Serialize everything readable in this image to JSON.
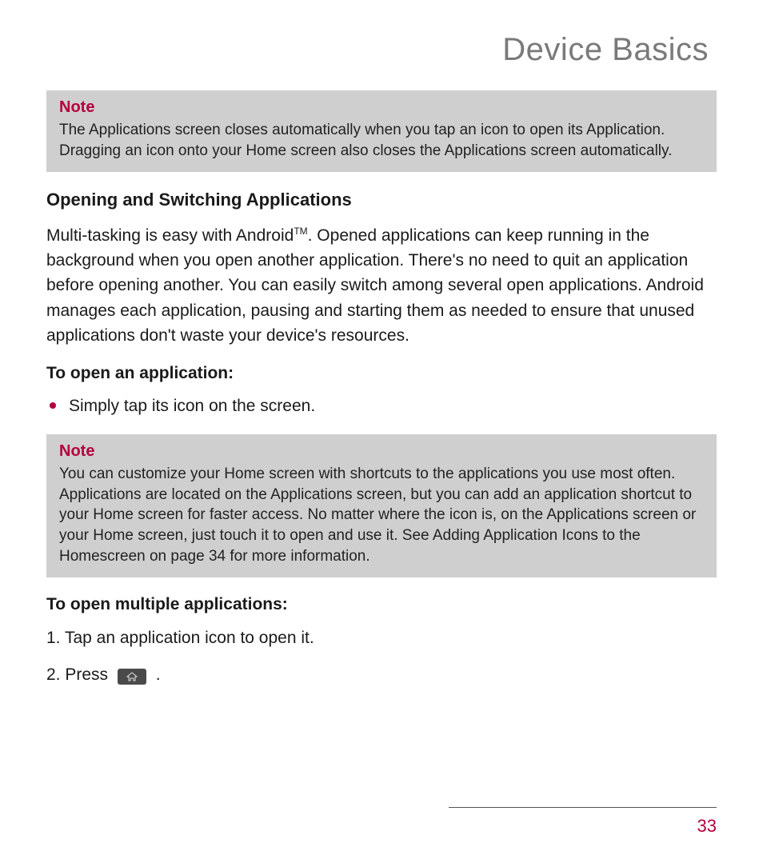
{
  "page_title": "Device Basics",
  "note1": {
    "label": "Note",
    "body": "The Applications screen closes automatically when you tap an icon to open its Application. Dragging an icon onto your Home screen also closes the Applications screen automatically."
  },
  "section_heading": "Opening and Switching Applications",
  "body_para_pre": "Multi-tasking is easy with Android",
  "tm": "TM",
  "body_para_post": ". Opened applications can keep running in the background when you open another application. There's no need to quit an application before opening another. You can easily switch among several open applications. Android manages each application, pausing and starting them as needed to ensure that unused applications don't waste your device's resources.",
  "to_open_heading": "To open an application:",
  "bullet_text": "Simply tap its icon on the screen.",
  "note2": {
    "label": "Note",
    "body": "You can customize your Home screen with shortcuts to the applications you use most often. Applications are located on the Applications screen, but you can add an application shortcut to your Home screen for faster access. No matter where the icon is, on the Applications screen or your Home screen, just touch it to open and use it. See Adding Application Icons to the Homescreen on page 34 for more information."
  },
  "to_open_multiple_heading": "To open multiple applications:",
  "step1": "1. Tap an application icon to open it.",
  "step2_pre": "2. Press ",
  "step2_post": " .",
  "page_number": "33"
}
